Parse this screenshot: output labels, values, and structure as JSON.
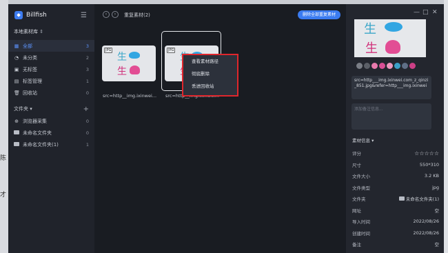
{
  "app": {
    "name": "Billfish",
    "library": "本地素材库"
  },
  "sidebar": {
    "items": [
      {
        "label": "全部",
        "count": "3",
        "icon": "grid-icon"
      },
      {
        "label": "未分类",
        "count": "2",
        "icon": "pie-icon"
      },
      {
        "label": "无标签",
        "count": "3",
        "icon": "tag-off-icon"
      },
      {
        "label": "标签管理",
        "count": "1",
        "icon": "tag-icon"
      },
      {
        "label": "回收站",
        "count": "0",
        "icon": "trash-icon"
      }
    ],
    "folders_label": "文件夹",
    "folders": [
      {
        "label": "浏览器采集",
        "count": "0",
        "icon": "globe-icon"
      },
      {
        "label": "未命名文件夹",
        "count": "0",
        "icon": "folder-icon"
      },
      {
        "label": "未命名文件夹(1)",
        "count": "1",
        "icon": "folder-icon"
      }
    ]
  },
  "main": {
    "title": "重复素材(2)",
    "clear_button": "删除全部重复素材",
    "cards": [
      {
        "badge": "JPG",
        "caption": "src=http__img.ixinwei..."
      },
      {
        "badge": "JPG",
        "caption": "src=http__img.ixinwei..."
      }
    ],
    "thumb_text": {
      "top": "生",
      "bottom": "生"
    },
    "context_menu": [
      "查看素材路径",
      "彻底删除",
      "丢进回收站"
    ]
  },
  "right": {
    "window_controls": {
      "minimize": "—",
      "maximize": "□",
      "close": "✕"
    },
    "swatches": [
      "#7a7e86",
      "#5b5f67",
      "#e87aac",
      "#d94f95",
      "#ee96bd",
      "#3b9fc6",
      "#5f6f86",
      "#cc3f86"
    ],
    "filename": "src=http___img.ixinwei.com_z_qinzi_851.jpg&refer=http___img.ixinwei",
    "note_placeholder": "添加备注信息...",
    "info_title": "素材信息",
    "info": [
      {
        "key": "评分",
        "value": "☆☆☆☆☆"
      },
      {
        "key": "尺寸",
        "value": "550*310"
      },
      {
        "key": "文件大小",
        "value": "3.2 KB"
      },
      {
        "key": "文件类型",
        "value": "jpg"
      },
      {
        "key": "文件夹",
        "value": "未命名文件夹(1)"
      },
      {
        "key": "网址",
        "value": "空"
      },
      {
        "key": "导入时间",
        "value": "2022/08/26"
      },
      {
        "key": "创建时间",
        "value": "2022/08/26"
      },
      {
        "key": "备注",
        "value": "空"
      }
    ]
  },
  "background": {
    "chars": [
      "陈",
      "才"
    ]
  }
}
